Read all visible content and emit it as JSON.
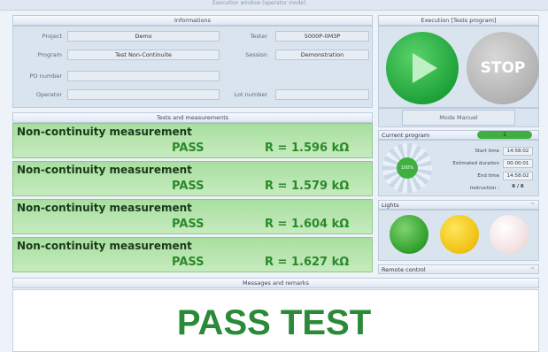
{
  "window": {
    "title": "Execution window (operator mode)"
  },
  "informations": {
    "header": "Informations",
    "project_label": "Project",
    "project_value": "Demo",
    "program_label": "Program",
    "program_value": "Test Non-Continuite",
    "po_label": "PO number",
    "po_value": "",
    "operator_label": "Operator",
    "operator_value": "",
    "tester_label": "Tester",
    "tester_value": "5000P-0M3P",
    "session_label": "Session",
    "session_value": "Demonstration",
    "lot_label": "Lot number",
    "lot_value": ""
  },
  "execution": {
    "header": "Execution [Tests program]",
    "stop_label": "STOP",
    "mode_label": "Mode Manuel"
  },
  "current_program": {
    "header": "Current program",
    "value": "1",
    "percent": "100%",
    "start_label": "Start time",
    "start_value": "14:58:02",
    "duration_label": "Estimated duration",
    "duration_value": "00:00:01",
    "end_label": "End time",
    "end_value": "14:58:02",
    "instruction_label": "Instruction :",
    "instruction_value": "6 / 6"
  },
  "lights": {
    "header": "Lights"
  },
  "remote": {
    "header": "Remote control"
  },
  "tests": {
    "header": "Tests and measurements",
    "items": [
      {
        "title": "Non-continuity measurement",
        "status": "PASS",
        "result": "R = 1.596 kΩ"
      },
      {
        "title": "Non-continuity measurement",
        "status": "PASS",
        "result": "R = 1.579 kΩ"
      },
      {
        "title": "Non-continuity measurement",
        "status": "PASS",
        "result": "R = 1.604 kΩ"
      },
      {
        "title": "Non-continuity measurement",
        "status": "PASS",
        "result": "R = 1.627 kΩ"
      }
    ]
  },
  "messages": {
    "header": "Messages and remarks",
    "text": "PASS TEST"
  },
  "colors": {
    "pass_green": "#2a8a38",
    "accent_green": "#3fb040"
  },
  "icons": {
    "play": "play-icon",
    "collapse": "chevron-up-icon"
  }
}
